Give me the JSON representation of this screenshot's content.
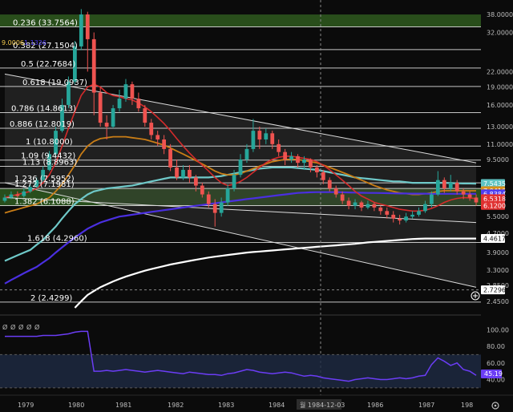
{
  "chart_data": {
    "type": "candlestick",
    "price_axis": {
      "scale": "log",
      "ticks": [
        "38.0000",
        "32.0000",
        "22.0000",
        "19.0000",
        "16.0000",
        "13.0000",
        "11.0000",
        "9.5000",
        "5.5000",
        "4.7000",
        "3.9000",
        "3.3000",
        "2.8500",
        "2.4500"
      ]
    },
    "time_axis": {
      "ticks": [
        "1979",
        "1980",
        "1981",
        "1982",
        "1983",
        "1984",
        "1986",
        "1987",
        "198"
      ],
      "crosshair_label": "월 1984-12-03"
    },
    "header_values": [
      "9.0006",
      "1.1326"
    ],
    "fib_levels": [
      {
        "ratio": "0.236",
        "value": "33.7564",
        "label": "0.236 (33.7564)"
      },
      {
        "ratio": "0.382",
        "value": "27.1504",
        "label": "0.382 (27.1504)"
      },
      {
        "ratio": "0.5",
        "value": "22.7684",
        "label": "0.5 (22.7684)"
      },
      {
        "ratio": "0.618",
        "value": "19.0937",
        "label": "0.618 (19.0937)"
      },
      {
        "ratio": "0.786",
        "value": "14.8613",
        "label": "0.786 (14.8613)"
      },
      {
        "ratio": "0.886",
        "value": "12.8019",
        "label": "0.886 (12.8019)"
      },
      {
        "ratio": "1",
        "value": "10.8000",
        "label": "1 (10.8000)"
      },
      {
        "ratio": "1.09",
        "value": "9.4432",
        "label": "1.09 (9.4432)"
      },
      {
        "ratio": "1.13",
        "value": "8.8963",
        "label": "1.13 (8.8963)"
      },
      {
        "ratio": "1.236",
        "value": "7.5952",
        "label": "1.236 (7.5952)"
      },
      {
        "ratio": "1.272",
        "value": "7.1981",
        "label": "1.272 (7.1981)"
      },
      {
        "ratio": "1.382",
        "value": "6.1088",
        "label": "1.382 (6.1088)"
      },
      {
        "ratio": "1.618",
        "value": "4.2960",
        "label": "1.618 (4.2960)"
      },
      {
        "ratio": "2",
        "value": "2.4299",
        "label": "2 (2.4299)"
      }
    ],
    "price_badges": [
      {
        "text": "7.5435",
        "color": "#5ec4c4"
      },
      {
        "text": "7.0416",
        "color": "#d9901c"
      },
      {
        "text": "6.8384",
        "color": "#4d3df0"
      },
      {
        "text": "6.5318",
        "color": "#e03131"
      },
      {
        "text": "6.1200",
        "color": "#e03131"
      },
      {
        "text": "4.4617",
        "color": "#ffffff"
      },
      {
        "text": "2.7296",
        "color": "#ffffff"
      }
    ],
    "candles": [
      [
        6.4,
        6.6,
        6.8,
        6.3
      ],
      [
        6.6,
        6.8,
        7.0,
        6.5
      ],
      [
        6.8,
        6.7,
        7.0,
        6.6
      ],
      [
        6.7,
        7.0,
        7.2,
        6.6
      ],
      [
        7.0,
        7.3,
        7.5,
        6.9
      ],
      [
        7.3,
        7.8,
        8.0,
        7.2
      ],
      [
        7.8,
        8.6,
        8.9,
        7.7
      ],
      [
        8.6,
        10.0,
        10.3,
        8.5
      ],
      [
        10.0,
        12.5,
        13.0,
        9.8
      ],
      [
        12.5,
        16.0,
        17.0,
        12.3
      ],
      [
        16.0,
        20.0,
        21.0,
        15.5
      ],
      [
        20.0,
        28.0,
        29.5,
        19.5
      ],
      [
        28.0,
        38.0,
        40.0,
        27.0
      ],
      [
        38.0,
        30.0,
        39.0,
        22.0
      ],
      [
        30.0,
        18.0,
        32.0,
        14.5
      ],
      [
        18.0,
        13.5,
        19.0,
        13.0
      ],
      [
        13.5,
        13.0,
        14.5,
        11.5
      ],
      [
        13.0,
        15.5,
        16.0,
        12.8
      ],
      [
        15.5,
        17.0,
        18.5,
        15.0
      ],
      [
        17.0,
        19.5,
        20.5,
        16.5
      ],
      [
        19.5,
        17.0,
        20.0,
        16.0
      ],
      [
        17.0,
        15.5,
        18.0,
        15.0
      ],
      [
        15.5,
        13.5,
        16.0,
        13.0
      ],
      [
        13.5,
        12.0,
        14.0,
        11.5
      ],
      [
        12.0,
        11.5,
        12.5,
        10.8
      ],
      [
        11.5,
        10.5,
        12.0,
        10.0
      ],
      [
        10.5,
        8.8,
        11.0,
        8.5
      ],
      [
        8.8,
        8.0,
        9.5,
        7.8
      ],
      [
        8.0,
        8.6,
        9.0,
        7.8
      ],
      [
        8.6,
        8.0,
        9.0,
        7.6
      ],
      [
        8.0,
        7.4,
        8.2,
        7.0
      ],
      [
        7.4,
        6.8,
        7.6,
        6.6
      ],
      [
        6.8,
        6.2,
        7.0,
        6.0
      ],
      [
        6.2,
        5.7,
        6.5,
        5.0
      ],
      [
        5.7,
        6.3,
        6.6,
        5.5
      ],
      [
        6.3,
        7.2,
        7.5,
        6.1
      ],
      [
        7.2,
        8.2,
        8.6,
        7.0
      ],
      [
        8.2,
        9.5,
        10.0,
        8.0
      ],
      [
        9.5,
        10.5,
        11.0,
        9.2
      ],
      [
        10.5,
        12.5,
        14.0,
        10.2
      ],
      [
        12.5,
        11.5,
        13.0,
        10.5
      ],
      [
        11.5,
        12.2,
        12.8,
        11.0
      ],
      [
        12.2,
        11.0,
        12.5,
        10.5
      ],
      [
        11.0,
        10.2,
        11.5,
        9.8
      ],
      [
        10.2,
        9.5,
        10.5,
        9.0
      ],
      [
        9.5,
        9.8,
        10.2,
        9.2
      ],
      [
        9.8,
        9.2,
        10.0,
        8.8
      ],
      [
        9.2,
        9.5,
        9.8,
        8.6
      ],
      [
        9.5,
        8.8,
        9.6,
        8.4
      ],
      [
        8.8,
        8.4,
        9.0,
        8.0
      ],
      [
        8.4,
        7.8,
        8.6,
        7.5
      ],
      [
        7.8,
        7.2,
        8.0,
        7.0
      ],
      [
        7.2,
        6.8,
        7.4,
        6.6
      ],
      [
        6.8,
        6.4,
        7.0,
        6.2
      ],
      [
        6.4,
        6.1,
        6.6,
        5.9
      ],
      [
        6.1,
        6.3,
        6.5,
        5.9
      ],
      [
        6.3,
        6.0,
        6.4,
        5.8
      ],
      [
        6.0,
        6.2,
        6.4,
        5.9
      ],
      [
        6.2,
        6.0,
        6.3,
        5.8
      ],
      [
        6.0,
        5.8,
        6.1,
        5.6
      ],
      [
        5.8,
        5.6,
        6.0,
        5.4
      ],
      [
        5.6,
        5.4,
        5.8,
        5.2
      ],
      [
        5.4,
        5.3,
        5.6,
        5.1
      ],
      [
        5.3,
        5.5,
        5.7,
        5.2
      ],
      [
        5.5,
        5.6,
        5.8,
        5.4
      ],
      [
        5.6,
        5.8,
        6.0,
        5.5
      ],
      [
        5.8,
        6.2,
        6.4,
        5.7
      ],
      [
        6.2,
        6.8,
        7.0,
        6.0
      ],
      [
        6.8,
        7.8,
        8.5,
        6.7
      ],
      [
        7.8,
        7.2,
        8.0,
        6.9
      ],
      [
        7.2,
        7.6,
        8.2,
        7.0
      ],
      [
        7.6,
        7.0,
        7.8,
        6.8
      ],
      [
        7.0,
        6.8,
        7.2,
        6.5
      ],
      [
        6.8,
        6.6,
        7.0,
        6.4
      ],
      [
        6.6,
        6.3,
        6.8,
        6.1
      ]
    ],
    "indicators": {
      "red_ma": [
        6.6,
        6.7,
        6.8,
        6.9,
        7.0,
        7.2,
        7.6,
        8.2,
        9.2,
        10.8,
        12.8,
        15.0,
        17.5,
        19.0,
        19.5,
        19.0,
        18.0,
        17.5,
        17.3,
        17.0,
        16.8,
        16.3,
        15.7,
        15.0,
        14.2,
        13.4,
        12.5,
        11.6,
        10.8,
        10.1,
        9.5,
        9.0,
        8.5,
        8.0,
        7.6,
        7.4,
        7.5,
        7.7,
        8.0,
        8.4,
        8.8,
        9.2,
        9.5,
        9.7,
        9.8,
        9.8,
        9.7,
        9.6,
        9.5,
        9.3,
        9.0,
        8.6,
        8.2,
        7.8,
        7.4,
        7.0,
        6.7,
        6.5,
        6.3,
        6.2,
        6.1,
        6.0,
        5.9,
        5.85,
        5.8,
        5.8,
        5.85,
        5.95,
        6.1,
        6.3,
        6.45,
        6.55,
        6.6,
        6.58,
        6.53
      ],
      "orange_ma": [
        5.7,
        5.8,
        5.9,
        6.0,
        6.1,
        6.2,
        6.4,
        6.6,
        7.0,
        7.5,
        8.2,
        9.0,
        10.0,
        10.8,
        11.3,
        11.6,
        11.7,
        11.8,
        11.8,
        11.8,
        11.7,
        11.6,
        11.5,
        11.3,
        11.1,
        10.9,
        10.6,
        10.3,
        10.0,
        9.7,
        9.4,
        9.1,
        8.8,
        8.5,
        8.3,
        8.2,
        8.2,
        8.3,
        8.5,
        8.7,
        8.9,
        9.1,
        9.3,
        9.4,
        9.5,
        9.5,
        9.5,
        9.4,
        9.3,
        9.2,
        9.0,
        8.8,
        8.6,
        8.4,
        8.2,
        8.0,
        7.8,
        7.6,
        7.4,
        7.25,
        7.1,
        7.0,
        6.9,
        6.85,
        6.8,
        6.8,
        6.85,
        6.9,
        7.0,
        7.05,
        7.05,
        7.05,
        7.05,
        7.04,
        7.04
      ],
      "teal_ma": [
        3.6,
        3.7,
        3.8,
        3.9,
        4.0,
        4.2,
        4.4,
        4.7,
        5.0,
        5.4,
        5.8,
        6.2,
        6.5,
        6.8,
        7.0,
        7.1,
        7.2,
        7.25,
        7.3,
        7.35,
        7.4,
        7.5,
        7.6,
        7.7,
        7.8,
        7.9,
        8.0,
        8.0,
        8.0,
        8.0,
        8.0,
        8.0,
        8.0,
        8.05,
        8.1,
        8.2,
        8.3,
        8.4,
        8.5,
        8.6,
        8.7,
        8.75,
        8.8,
        8.8,
        8.8,
        8.8,
        8.75,
        8.7,
        8.65,
        8.6,
        8.5,
        8.4,
        8.3,
        8.2,
        8.1,
        8.0,
        7.95,
        7.9,
        7.85,
        7.8,
        7.75,
        7.7,
        7.7,
        7.65,
        7.6,
        7.6,
        7.6,
        7.6,
        7.6,
        7.6,
        7.58,
        7.56,
        7.55,
        7.55,
        7.54
      ],
      "blue_ma": [
        2.9,
        3.0,
        3.1,
        3.2,
        3.3,
        3.4,
        3.55,
        3.7,
        3.9,
        4.1,
        4.3,
        4.5,
        4.7,
        4.9,
        5.05,
        5.2,
        5.3,
        5.4,
        5.5,
        5.55,
        5.6,
        5.65,
        5.7,
        5.75,
        5.8,
        5.85,
        5.9,
        5.95,
        6.0,
        6.05,
        6.1,
        6.15,
        6.2,
        6.25,
        6.3,
        6.35,
        6.4,
        6.45,
        6.5,
        6.55,
        6.6,
        6.65,
        6.7,
        6.75,
        6.8,
        6.85,
        6.9,
        6.92,
        6.94,
        6.95,
        6.95,
        6.95,
        6.95,
        6.94,
        6.93,
        6.92,
        6.91,
        6.9,
        6.9,
        6.89,
        6.88,
        6.87,
        6.86,
        6.86,
        6.85,
        6.85,
        6.85,
        6.84,
        6.84,
        6.84,
        6.84,
        6.84,
        6.84,
        6.84,
        6.84
      ],
      "white_ma_start_index": 11,
      "white_ma": [
        2.3,
        2.45,
        2.6,
        2.7,
        2.8,
        2.88,
        2.96,
        3.03,
        3.1,
        3.16,
        3.22,
        3.28,
        3.33,
        3.38,
        3.43,
        3.48,
        3.52,
        3.56,
        3.6,
        3.64,
        3.68,
        3.72,
        3.75,
        3.78,
        3.81,
        3.84,
        3.87,
        3.9,
        3.92,
        3.94,
        3.96,
        3.98,
        4.0,
        4.02,
        4.04,
        4.06,
        4.08,
        4.1,
        4.12,
        4.14,
        4.16,
        4.18,
        4.2,
        4.22,
        4.24,
        4.27,
        4.3,
        4.32,
        4.34,
        4.36,
        4.38,
        4.4,
        4.42,
        4.44,
        4.45,
        4.46,
        4.46,
        4.46,
        4.46,
        4.46,
        4.46,
        4.46,
        4.46,
        4.46
      ]
    },
    "trendlines": [
      {
        "from": [
          0,
          21.5
        ],
        "to": [
          74,
          9.2
        ]
      },
      {
        "from": [
          0,
          7.6
        ],
        "to": [
          74,
          2.8
        ]
      },
      {
        "from": [
          0,
          6.6
        ],
        "to": [
          74,
          5.2
        ]
      }
    ],
    "oscillator": {
      "axis_ticks": [
        "100.00",
        "80.00",
        "60.00",
        "40.00"
      ],
      "current_value": "45.19",
      "header_symbols": [
        "Ø",
        "Ø",
        "Ø",
        "Ø",
        "Ø"
      ],
      "values": [
        92,
        92,
        92,
        92,
        92,
        92,
        93,
        93,
        93,
        94,
        95,
        97,
        98,
        98,
        50,
        50,
        51,
        50,
        51,
        52,
        51,
        50,
        49,
        50,
        51,
        50,
        49,
        48,
        47,
        49,
        48,
        47,
        46,
        46,
        45,
        47,
        48,
        50,
        52,
        51,
        49,
        48,
        47,
        48,
        49,
        48,
        46,
        44,
        45,
        44,
        42,
        41,
        40,
        39,
        38,
        40,
        41,
        42,
        41,
        40,
        40,
        41,
        42,
        41,
        42,
        44,
        45,
        58,
        66,
        62,
        57,
        60,
        52,
        50,
        45
      ]
    }
  }
}
